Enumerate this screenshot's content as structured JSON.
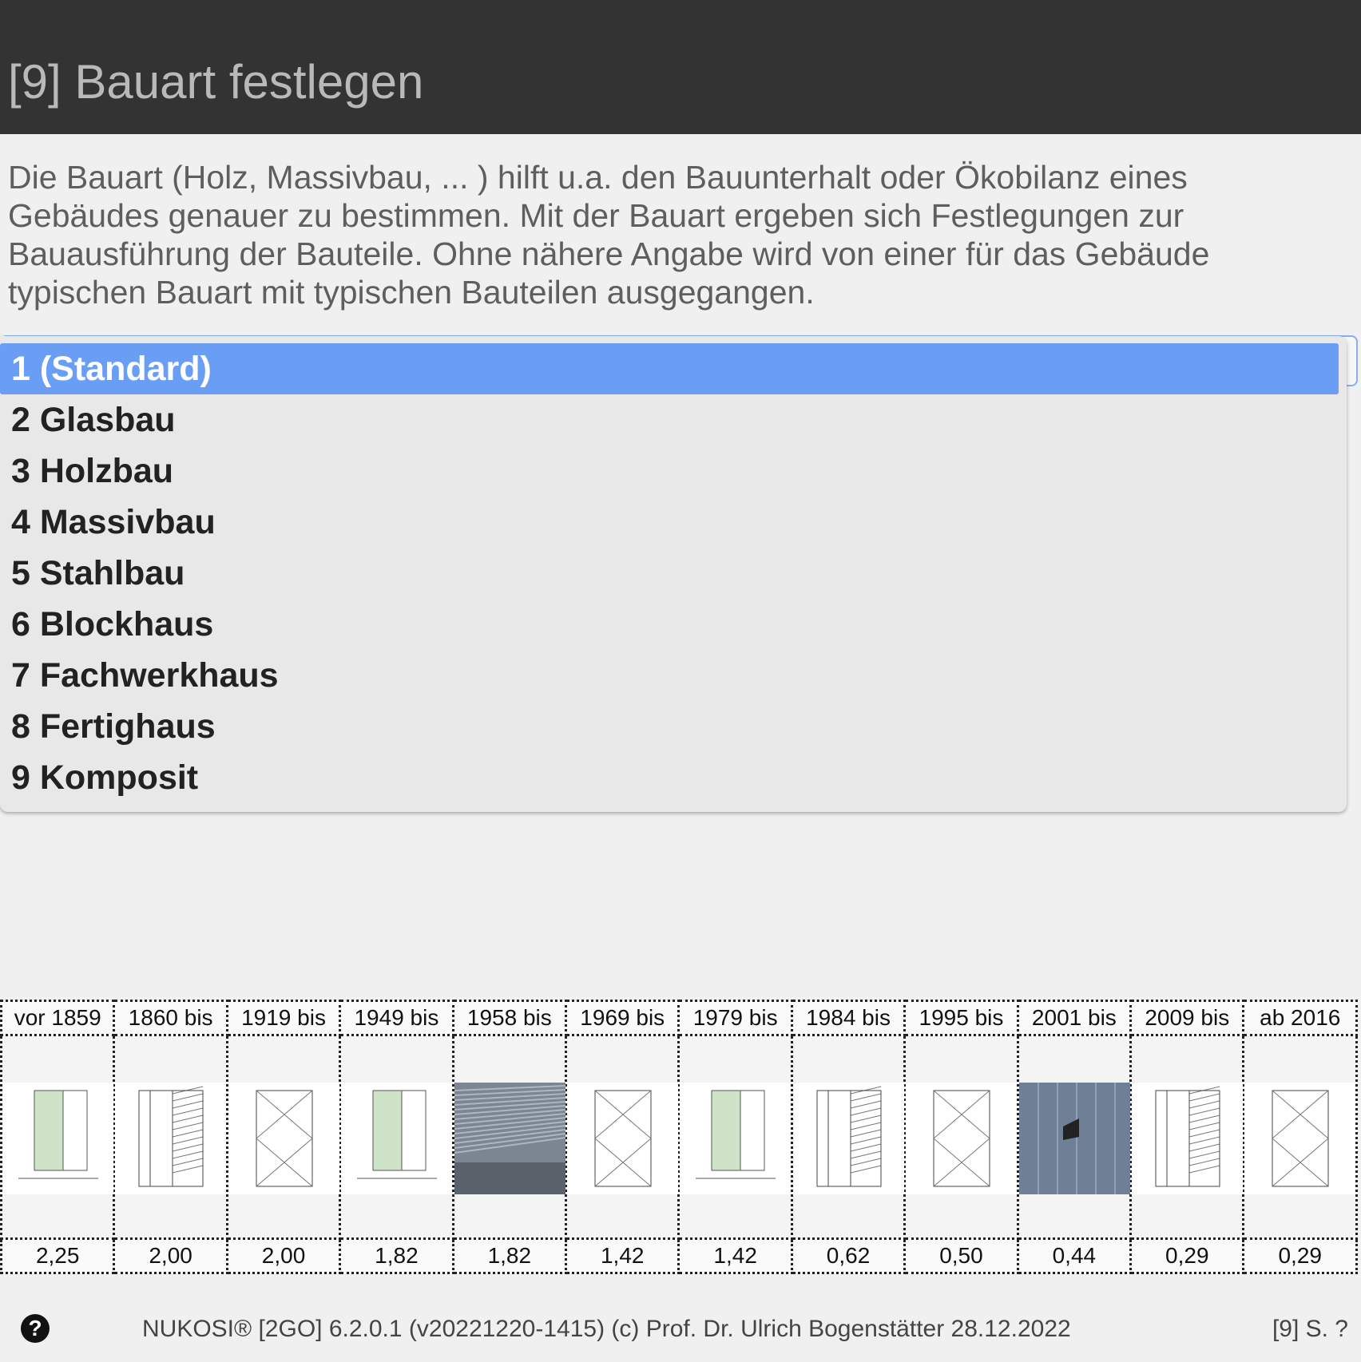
{
  "header": {
    "title": "[9] Bauart festlegen"
  },
  "description": "Die Bauart (Holz, Massivbau, ... ) hilft u.a. den Bauunterhalt oder Ökobilanz eines Gebäudes genauer zu bestimmen. Mit der Bauart ergeben sich Festlegungen zur Bauausführung der Bauteile. Ohne nähere Angabe wird von einer für das Gebäude typischen Bauart mit typischen Bauteilen ausgegangen.",
  "dropdown": {
    "selected_index": 0,
    "options": [
      "1 (Standard)",
      "2 Glasbau",
      "3 Holzbau",
      "4 Massivbau",
      "5 Stahlbau",
      "6 Blockhaus",
      "7 Fachwerkhaus",
      "8 Fertighaus",
      "9 Komposit"
    ]
  },
  "periods": [
    {
      "label": "vor 1859",
      "value": "2,25",
      "image": "wall-section-drawing"
    },
    {
      "label": "1860 bis",
      "value": "2,00",
      "image": "wall-section-drawing"
    },
    {
      "label": "1919 bis",
      "value": "2,00",
      "image": "wall-section-drawing"
    },
    {
      "label": "1949 bis",
      "value": "1,82",
      "image": "wall-section-drawing"
    },
    {
      "label": "1958 bis",
      "value": "1,82",
      "image": "building-photo"
    },
    {
      "label": "1969 bis",
      "value": "1,42",
      "image": "wall-section-drawing"
    },
    {
      "label": "1979 bis",
      "value": "1,42",
      "image": "wall-section-drawing"
    },
    {
      "label": "1984 bis",
      "value": "0,62",
      "image": "wall-section-drawing"
    },
    {
      "label": "1995 bis",
      "value": "0,50",
      "image": "wall-section-drawing"
    },
    {
      "label": "2001 bis",
      "value": "0,44",
      "image": "glass-facade-photo"
    },
    {
      "label": "2009 bis",
      "value": "0,29",
      "image": "wall-section-drawing"
    },
    {
      "label": "ab 2016",
      "value": "0,29",
      "image": "wall-section-drawing"
    }
  ],
  "footer": {
    "help_icon": "?",
    "text": "NUKOSI® [2GO] 6.2.0.1 (v20221220-1415) (c) Prof. Dr. Ulrich Bogenstätter  28.12.2022",
    "page_ref": "[9] S. ?"
  },
  "colors": {
    "header_bg": "#333333",
    "selected_bg": "#6a9ef5",
    "insulation_green": "#cfe3c9"
  }
}
